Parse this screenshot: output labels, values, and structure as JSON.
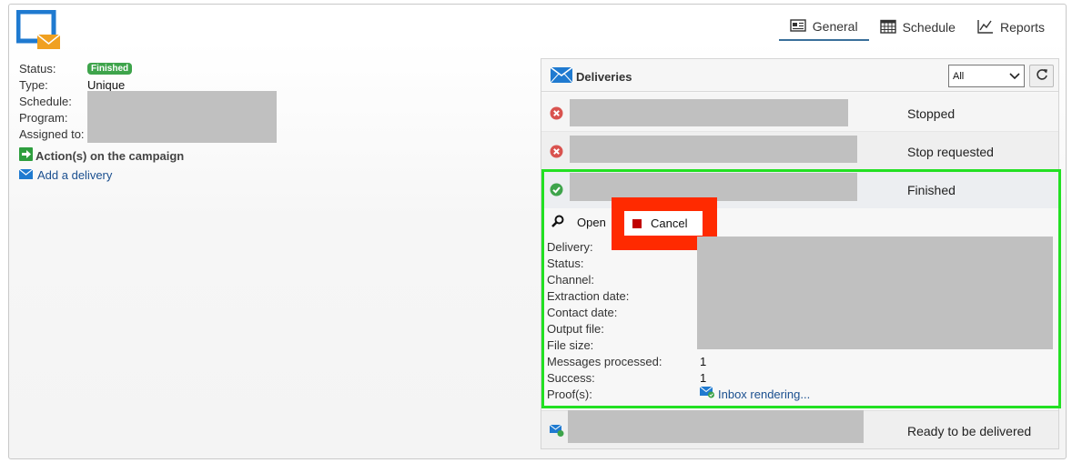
{
  "tabs": [
    {
      "label": "General",
      "icon": "general-icon",
      "active": true
    },
    {
      "label": "Schedule",
      "icon": "calendar-icon",
      "active": false
    },
    {
      "label": "Reports",
      "icon": "chart-icon",
      "active": false
    }
  ],
  "campaign": {
    "status_label": "Status:",
    "status_badge": "Finished",
    "type_label": "Type:",
    "type_value": "Unique",
    "schedule_label": "Schedule:",
    "program_label": "Program:",
    "assigned_label": "Assigned to:",
    "actions_title": "Action(s) on the campaign",
    "add_delivery": "Add a delivery"
  },
  "deliveries": {
    "title": "Deliveries",
    "filter_value": "All",
    "rows": [
      {
        "status": "Stopped",
        "icon": "error-icon"
      },
      {
        "status": "Stop requested",
        "icon": "error-icon"
      },
      {
        "status": "Finished",
        "icon": "check-icon"
      },
      {
        "status": "Ready to be delivered",
        "icon": "mail-ready-icon"
      }
    ],
    "selected": {
      "open_label": "Open",
      "cancel_label": "Cancel",
      "fields": {
        "delivery_label": "Delivery:",
        "status_label": "Status:",
        "channel_label": "Channel:",
        "extraction_label": "Extraction date:",
        "contact_label": "Contact date:",
        "output_label": "Output file:",
        "filesize_label": "File size:",
        "messages_label": "Messages processed:",
        "messages_value": "1",
        "success_label": "Success:",
        "success_value": "1",
        "proofs_label": "Proof(s):",
        "proofs_link": "Inbox rendering..."
      }
    }
  },
  "colors": {
    "brand_blue": "#1f7ad0",
    "brand_orange": "#f0a020",
    "selection_green": "#22e022",
    "highlight_red": "#ff2a00",
    "success_green": "#3ea44b",
    "link_blue": "#1a4f8f"
  }
}
